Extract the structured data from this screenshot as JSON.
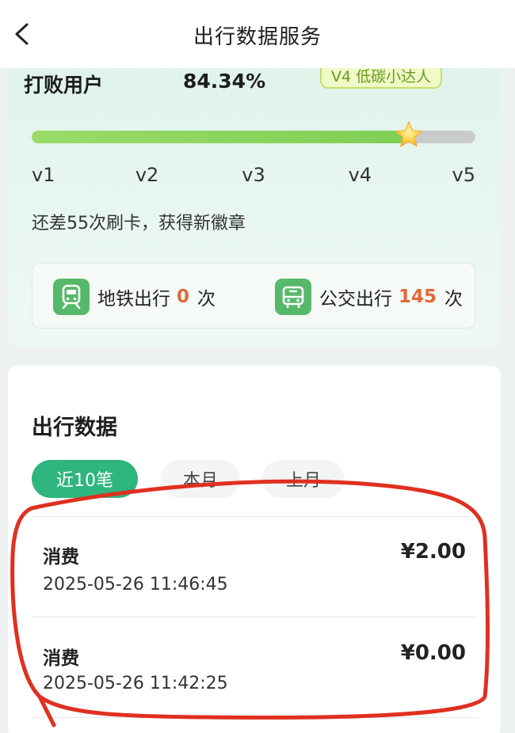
{
  "header": {
    "title": "出行数据服务"
  },
  "level": {
    "beat_label": "打败用户",
    "beat_value": "84.34%",
    "badge": "V4 低碳小达人",
    "progress": 0.85,
    "ticks": [
      "v1",
      "v2",
      "v3",
      "v4",
      "v5"
    ],
    "remain_text": "还差55次刷卡，获得新徽章"
  },
  "trips": {
    "metro": {
      "label": "地铁出行",
      "count": "0",
      "unit": "次",
      "icon": "metro-icon"
    },
    "bus": {
      "label": "公交出行",
      "count": "145",
      "unit": "次",
      "icon": "bus-icon"
    }
  },
  "data_section": {
    "title": "出行数据",
    "tabs": [
      "近10笔",
      "本月",
      "上月"
    ],
    "active_tab": 0,
    "records": [
      {
        "type": "消费",
        "amount": "¥2.00",
        "time": "2025-05-26 11:46:45"
      },
      {
        "type": "消费",
        "amount": "¥0.00",
        "time": "2025-05-26 11:42:25"
      }
    ]
  },
  "colors": {
    "accent": "#2fb57e",
    "count": "#e2693a",
    "annotation": "#e03020"
  }
}
